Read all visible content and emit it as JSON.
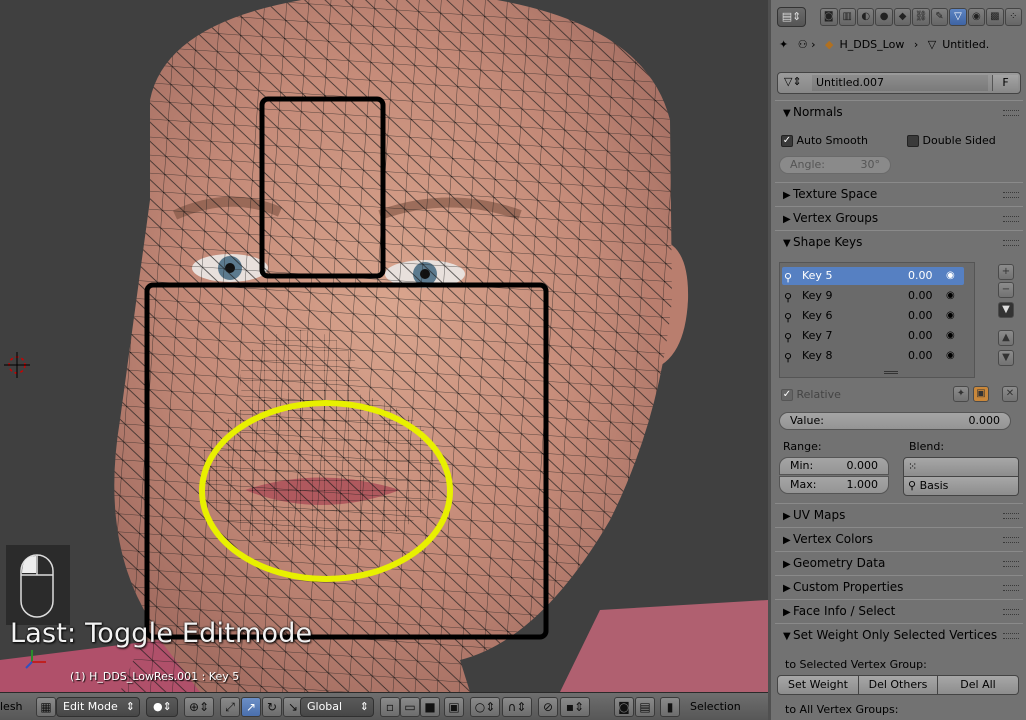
{
  "viewport": {
    "operator_overlay": "Last: Toggle Editmode",
    "object_info": "(1) H_DDS_LowRes.001 : Key 5"
  },
  "header3d": {
    "editor_label": "lesh",
    "mode": "Edit Mode",
    "orientation": "Global",
    "selection_label": "Selection"
  },
  "properties": {
    "breadcrumb": {
      "object": "H_DDS_Low",
      "data": "Untitled."
    },
    "mesh_datablock": {
      "name": "Untitled.007",
      "fake_user": "F"
    },
    "normals": {
      "title": "Normals",
      "auto_smooth": "Auto Smooth",
      "double_sided": "Double Sided",
      "angle_label": "Angle:",
      "angle_value": "30°"
    },
    "panels_collapsed_top": [
      "Texture Space",
      "Vertex Groups"
    ],
    "shape_keys": {
      "title": "Shape Keys",
      "keys": [
        {
          "name": "Key 5",
          "value": "0.00",
          "selected": true
        },
        {
          "name": "Key 9",
          "value": "0.00",
          "selected": false
        },
        {
          "name": "Key 6",
          "value": "0.00",
          "selected": false
        },
        {
          "name": "Key 7",
          "value": "0.00",
          "selected": false
        },
        {
          "name": "Key 8",
          "value": "0.00",
          "selected": false
        }
      ],
      "relative_label": "Relative",
      "value_label": "Value:",
      "value": "0.000",
      "range_label": "Range:",
      "blend_label": "Blend:",
      "min_label": "Min:",
      "min_value": "0.000",
      "max_label": "Max:",
      "max_value": "1.000",
      "blend_value": "Basis"
    },
    "panels_collapsed_bottom": [
      "UV Maps",
      "Vertex Colors",
      "Geometry Data",
      "Custom Properties",
      "Face Info / Select"
    ],
    "set_weight": {
      "title": "Set Weight Only Selected Vertices",
      "to_selected": "to Selected Vertex Group:",
      "set_weight_btn": "Set Weight",
      "del_others_btn": "Del Others",
      "del_all_btn": "Del All",
      "to_all": "to All Vertex Groups:"
    }
  },
  "colors": {
    "selection_blue": "#5680c2",
    "annotation_yellow": "#e8f000",
    "annotation_black": "#000000"
  }
}
